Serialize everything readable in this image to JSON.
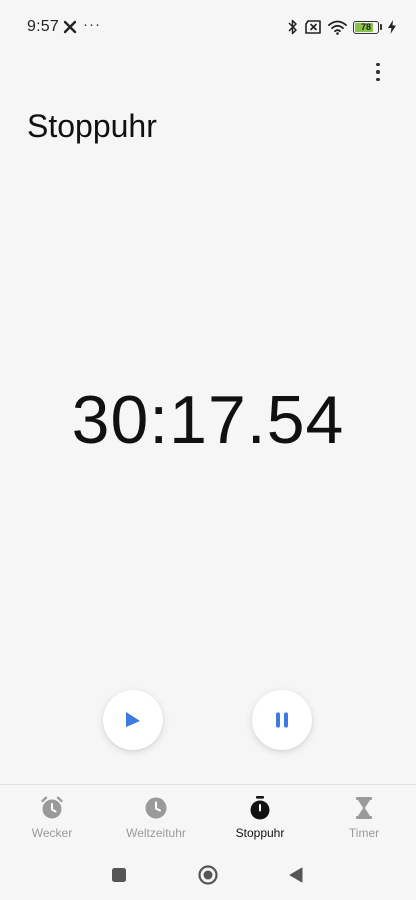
{
  "status_bar": {
    "time": "9:57",
    "battery_level": "78",
    "battery_color": "#8bc34a"
  },
  "app": {
    "title": "Stoppuhr",
    "more_icon": "more-vert-icon"
  },
  "stopwatch": {
    "elapsed": "30:17.54",
    "lap_icon": "flag-icon",
    "pause_icon": "pause-icon",
    "accent_color": "#3d7be0"
  },
  "bottom_nav": {
    "items": [
      {
        "label": "Wecker",
        "icon": "alarm-clock-icon",
        "active": false
      },
      {
        "label": "Weltzeituhr",
        "icon": "clock-icon",
        "active": false
      },
      {
        "label": "Stoppuhr",
        "icon": "stopwatch-icon",
        "active": true
      },
      {
        "label": "Timer",
        "icon": "hourglass-icon",
        "active": false
      }
    ]
  },
  "system_nav": {
    "recents_icon": "square-icon",
    "home_icon": "circle-icon",
    "back_icon": "triangle-back-icon"
  }
}
